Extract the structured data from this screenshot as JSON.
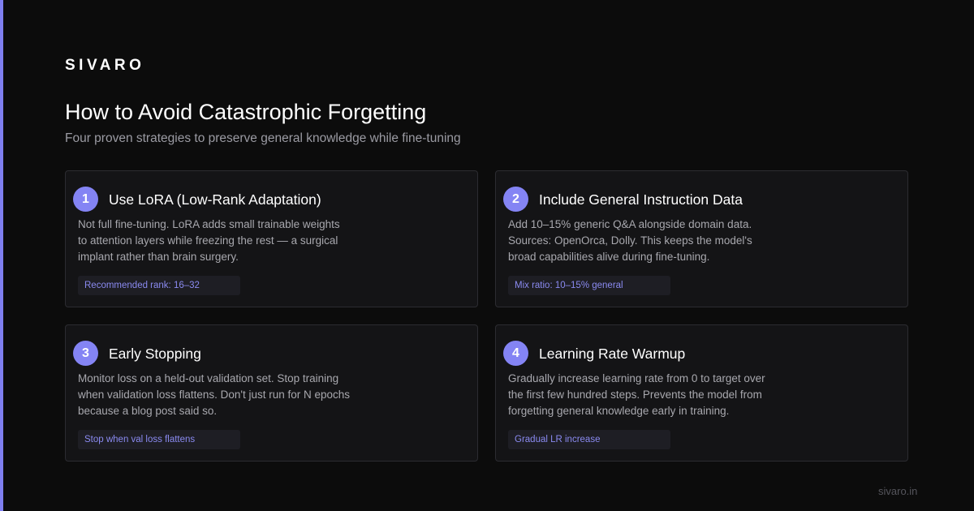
{
  "brand": {
    "name": "SIVARO",
    "domain": "sivaro.in",
    "accent_color": "#7f7ff0"
  },
  "header": {
    "title": "How to Avoid Catastrophic Forgetting",
    "subtitle": "Four proven strategies to preserve general knowledge while fine-tuning"
  },
  "cards": [
    {
      "number": "1",
      "title": "Use LoRA (Low-Rank Adaptation)",
      "body": [
        "Not full fine-tuning. LoRA adds small trainable weights",
        "to attention layers while freezing the rest — a surgical",
        "implant rather than brain surgery."
      ],
      "tag": "Recommended rank: 16–32"
    },
    {
      "number": "2",
      "title": "Include General Instruction Data",
      "body": [
        "Add 10–15% generic Q&A alongside domain data.",
        "Sources: OpenOrca, Dolly. This keeps the model's",
        "broad capabilities alive during fine-tuning."
      ],
      "tag": "Mix ratio: 10–15% general"
    },
    {
      "number": "3",
      "title": "Early Stopping",
      "body": [
        "Monitor loss on a held-out validation set. Stop training",
        "when validation loss flattens. Don't just run for N epochs",
        "because a blog post said so."
      ],
      "tag": "Stop when val loss flattens"
    },
    {
      "number": "4",
      "title": "Learning Rate Warmup",
      "body": [
        "Gradually increase learning rate from 0 to target over",
        "the first few hundred steps. Prevents the model from",
        "forgetting general knowledge early in training."
      ],
      "tag": "Gradual LR increase"
    }
  ]
}
